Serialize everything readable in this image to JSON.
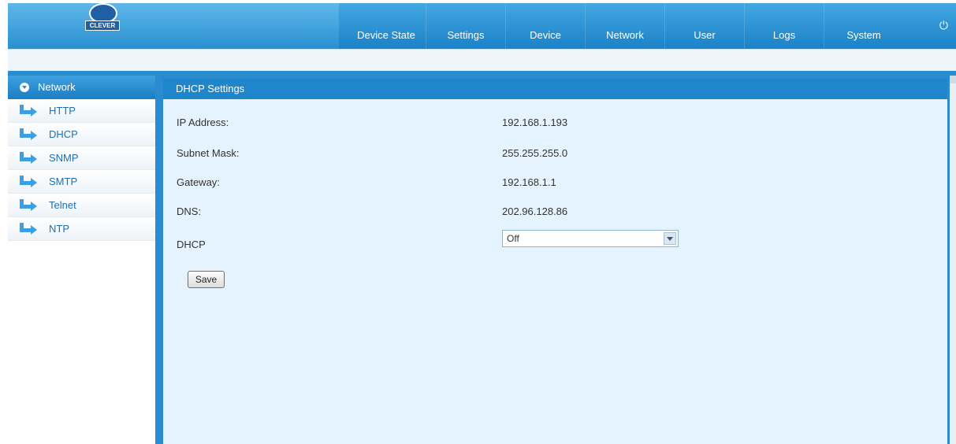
{
  "header": {
    "logo_text": "CLEVER",
    "nav": [
      "Device State",
      "Settings",
      "Device",
      "Network",
      "User",
      "Logs",
      "System"
    ],
    "power_icon": "power-icon"
  },
  "sidebar": {
    "title": "Network",
    "items": [
      "HTTP",
      "DHCP",
      "SNMP",
      "SMTP",
      "Telnet",
      "NTP"
    ]
  },
  "panel": {
    "title": "DHCP Settings",
    "rows": [
      {
        "label": "IP Address:",
        "value": "192.168.1.193"
      },
      {
        "label": "Subnet Mask:",
        "value": "255.255.255.0"
      },
      {
        "label": "Gateway:",
        "value": "192.168.1.1"
      },
      {
        "label": "DNS:",
        "value": "202.96.128.86"
      }
    ],
    "dhcp_label": "DHCP",
    "dhcp_value": "Off",
    "save_label": "Save"
  },
  "colors": {
    "header": "#1b82c8",
    "panel_bg": "#e4f3fd",
    "accent": "#2a8bd0"
  }
}
